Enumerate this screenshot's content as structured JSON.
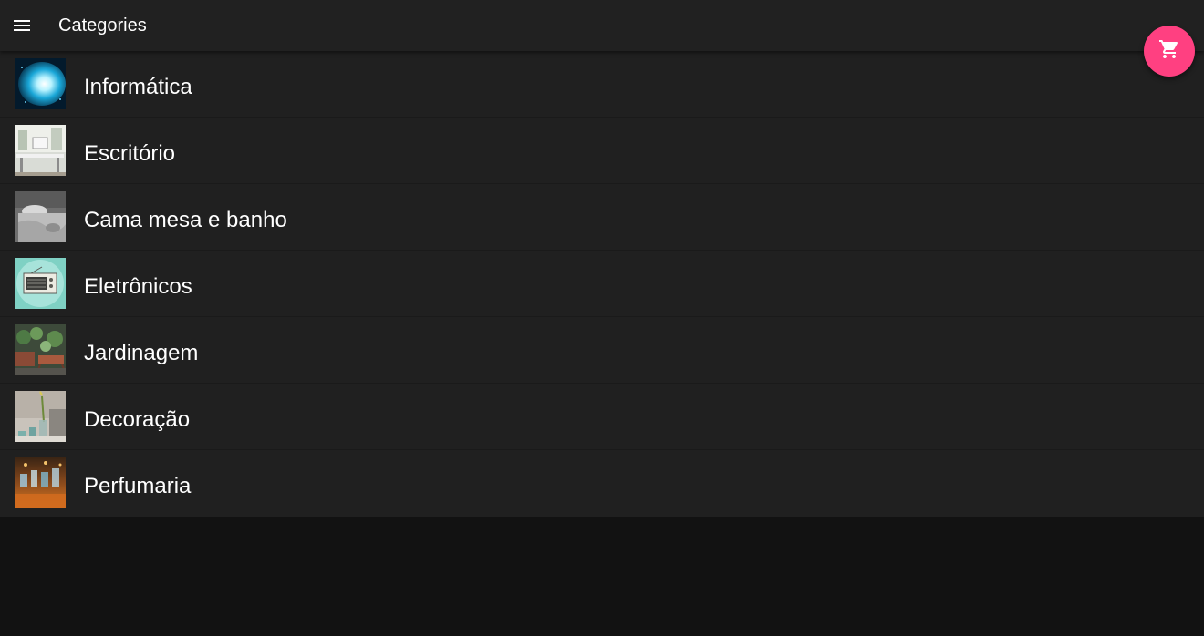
{
  "toolbar": {
    "title": "Categories",
    "menu_icon": "menu-icon"
  },
  "fab": {
    "icon": "cart-icon",
    "color": "#ff4081"
  },
  "categories": [
    {
      "label": "Informática",
      "thumbnail": "informatica-thumbnail"
    },
    {
      "label": "Escritório",
      "thumbnail": "escritorio-thumbnail"
    },
    {
      "label": "Cama mesa e banho",
      "thumbnail": "cama-mesa-banho-thumbnail"
    },
    {
      "label": "Eletrônicos",
      "thumbnail": "eletronicos-thumbnail"
    },
    {
      "label": "Jardinagem",
      "thumbnail": "jardinagem-thumbnail"
    },
    {
      "label": "Decoração",
      "thumbnail": "decoracao-thumbnail"
    },
    {
      "label": "Perfumaria",
      "thumbnail": "perfumaria-thumbnail"
    }
  ]
}
